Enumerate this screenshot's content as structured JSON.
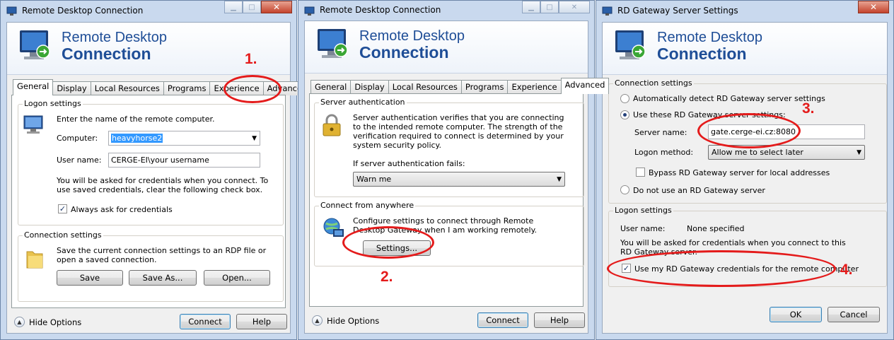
{
  "window1": {
    "title": "Remote Desktop Connection",
    "banner_line1": "Remote Desktop",
    "banner_line2": "Connection",
    "tabs": [
      "General",
      "Display",
      "Local Resources",
      "Programs",
      "Experience",
      "Advanced"
    ],
    "logon_group": "Logon settings",
    "logon_intro": "Enter the name of the remote computer.",
    "computer_label": "Computer:",
    "computer_value": "heavyhorse2",
    "username_label": "User name:",
    "username_value": "CERGE-EI\\your username",
    "credentials_note": "You will be asked for credentials when you connect. To use saved credentials, clear the following check box.",
    "always_ask_label": "Always ask for credentials",
    "conn_group": "Connection settings",
    "conn_text": "Save the current connection settings to an RDP file or open a saved connection.",
    "save_btn": "Save",
    "saveas_btn": "Save As...",
    "open_btn": "Open...",
    "hide_options": "Hide Options",
    "connect_btn": "Connect",
    "help_btn": "Help"
  },
  "window2": {
    "title": "Remote Desktop Connection",
    "banner_line1": "Remote Desktop",
    "banner_line2": "Connection",
    "tabs": [
      "General",
      "Display",
      "Local Resources",
      "Programs",
      "Experience",
      "Advanced"
    ],
    "server_auth_group": "Server authentication",
    "server_auth_text": "Server authentication verifies that you are connecting to the intended remote computer. The strength of the verification required to connect is determined by your system security policy.",
    "auth_fail_label": "If server authentication fails:",
    "auth_fail_value": "Warn me",
    "anywhere_group": "Connect from anywhere",
    "anywhere_text": "Configure settings to connect through Remote Desktop Gateway when I am working remotely.",
    "settings_btn": "Settings...",
    "hide_options": "Hide Options",
    "connect_btn": "Connect",
    "help_btn": "Help"
  },
  "window3": {
    "title": "RD Gateway Server Settings",
    "banner_line1": "Remote Desktop",
    "banner_line2": "Connection",
    "conn_group": "Connection settings",
    "auto_detect": "Automatically detect RD Gateway server settings",
    "use_these": "Use these RD Gateway server settings:",
    "server_name_label": "Server name:",
    "server_name_value": "gate.cerge-ei.cz:8080",
    "logon_method_label": "Logon method:",
    "logon_method_value": "Allow me to select later",
    "bypass_label": "Bypass RD Gateway server for local addresses",
    "no_gateway": "Do not use an RD Gateway server",
    "logon_group": "Logon settings",
    "user_name_label": "User name:",
    "user_name_value": "None specified",
    "cred_note": "You will be asked for credentials when you connect to this RD Gateway server.",
    "use_cred_label": "Use my RD Gateway credentials for the remote computer",
    "ok_btn": "OK",
    "cancel_btn": "Cancel"
  },
  "annotations": [
    "1.",
    "2.",
    "3.",
    "4."
  ],
  "colors": {
    "annotation": "#e41b1b",
    "banner_text": "#1f4e97",
    "selection": "#3399ff"
  }
}
